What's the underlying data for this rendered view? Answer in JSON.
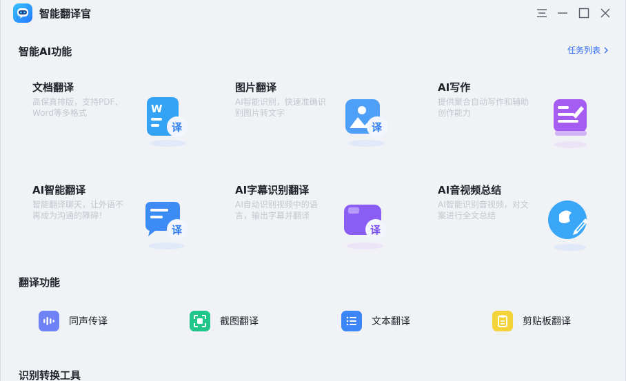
{
  "app": {
    "title": "智能翻译官"
  },
  "section_ai": {
    "title": "智能AI功能",
    "task_link": "任务列表",
    "cards": [
      {
        "title": "文档翻译",
        "desc": "高保真排版，支持PDF、Word等多格式",
        "icon": "word-doc-translate-icon"
      },
      {
        "title": "图片翻译",
        "desc": "AI智能识别，快速准确识别图片转文字",
        "icon": "image-translate-icon"
      },
      {
        "title": "AI写作",
        "desc": "提供聚合自动写作和辅助创作能力",
        "icon": "ai-writing-icon"
      },
      {
        "title": "AI智能翻译",
        "desc": "智能翻译聊天，让外语不再成为沟通的障碍！",
        "icon": "chat-translate-icon"
      },
      {
        "title": "AI字幕识别翻译",
        "desc": "AI自动识别视频中的语言，输出字幕并翻译",
        "icon": "video-subtitle-translate-icon"
      },
      {
        "title": "AI音视频总结",
        "desc": "AI智能识别音视频，对文案进行全文总结",
        "icon": "audio-video-summary-icon"
      }
    ]
  },
  "section_translate": {
    "title": "翻译功能",
    "tools": [
      {
        "label": "同声传译",
        "icon": "audio-wave-icon",
        "color": "#6e82f5"
      },
      {
        "label": "截图翻译",
        "icon": "screenshot-scan-icon",
        "color": "#22c68a"
      },
      {
        "label": "文本翻译",
        "icon": "text-list-icon",
        "color": "#3d86f7"
      },
      {
        "label": "剪贴板翻译",
        "icon": "clipboard-icon",
        "color": "#f3d23a"
      }
    ]
  },
  "section_convert": {
    "title": "识别转换工具"
  },
  "colors": {
    "accent": "#2f6cf6",
    "background": "#f1f2f6"
  }
}
